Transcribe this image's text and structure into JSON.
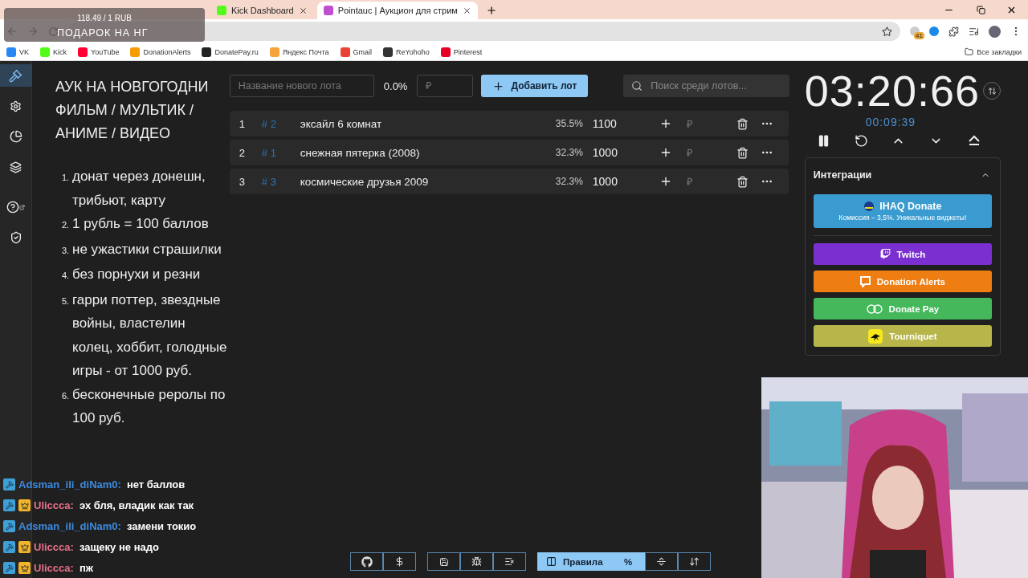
{
  "browser": {
    "tabs": [
      {
        "label": "Kick Dashboard",
        "selected": false,
        "color": "#53fc18"
      },
      {
        "label": "Pointauc | Аукцион для стрим",
        "selected": true,
        "color": "#c04fd0"
      }
    ],
    "bookmarks": [
      {
        "label": "VK",
        "color": "#2787f5"
      },
      {
        "label": "Kick",
        "color": "#53fc18"
      },
      {
        "label": "YouTube",
        "color": "#ff0033"
      },
      {
        "label": "DonationAlerts",
        "color": "#f59c07"
      },
      {
        "label": "DonatePay.ru",
        "color": "#222222"
      },
      {
        "label": "Яндекс Почта",
        "color": "#f7a23b"
      },
      {
        "label": "Gmail",
        "color": "#ea4335"
      },
      {
        "label": "ReYohoho",
        "color": "#333333"
      },
      {
        "label": "Pinterest",
        "color": "#e60023"
      }
    ],
    "all_bookmarks": "Все закладки",
    "extension_badge": "41"
  },
  "overlay_goal": {
    "amount": "118.49 / 1 RUB",
    "title": "ПОДАРОК НА НГ"
  },
  "rules": {
    "title": "АУК НА НОВГОГОДНИ ФИЛЬМ / МУЛЬТИК / АНИМЕ / ВИДЕО",
    "items": [
      {
        "number": "1.",
        "text": "донат через донешн, трибьют, карту"
      },
      {
        "number": "2.",
        "text": "1 рубль = 100 баллов"
      },
      {
        "number": "3.",
        "text": "не ужастики страшилки"
      },
      {
        "number": "4.",
        "text": "без порнухи и резни"
      },
      {
        "number": "5.",
        "text": "гарри поттер, звездные войны, властелин колец, хоббит, голодные игры - от 1000 руб."
      },
      {
        "number": "6.",
        "text": "бесконечные реролы по 100 руб."
      }
    ]
  },
  "new_lot": {
    "name_placeholder": "Название нового лота",
    "percent": "0.0%",
    "price_placeholder": "₽",
    "add_button": "Добавить лот",
    "search_placeholder": "Поиск среди лотов..."
  },
  "lots": [
    {
      "rank": "1",
      "id": "# 2",
      "name": "эксайл 6 комнат",
      "percent": "35.5%",
      "amount": "1100",
      "currency": "₽"
    },
    {
      "rank": "2",
      "id": "# 1",
      "name": "снежная пятерка (2008)",
      "percent": "32.3%",
      "amount": "1000",
      "currency": "₽"
    },
    {
      "rank": "3",
      "id": "# 3",
      "name": "космические друзья 2009",
      "percent": "32.3%",
      "amount": "1000",
      "currency": "₽"
    }
  ],
  "timer": {
    "main": "03:20:66",
    "elapsed": "00:09:39"
  },
  "integrations": {
    "title": "Интеграции",
    "expanded": true,
    "featured": {
      "label": "IHAQ Donate",
      "subtitle": "Комиссия – 3,5%. Уникальные виджеты!",
      "color": "#3a9bd0"
    },
    "items": [
      {
        "kind": "twitch",
        "label": "Twitch",
        "color": "#7b2fd0"
      },
      {
        "kind": "alerts",
        "label": "Donation Alerts",
        "color": "#ee7d12"
      },
      {
        "kind": "pay",
        "label": "Donate Pay",
        "color": "#44b85a"
      },
      {
        "kind": "tourniquet",
        "label": "Tourniquet",
        "color": "#b8b64a"
      }
    ]
  },
  "chat": [
    {
      "user": "Adsman_ili_diNam0:",
      "color": "#3d8be0",
      "badges": [
        {
          "kind": "mod"
        }
      ],
      "text": "нет баллов"
    },
    {
      "user": "Ulіccca:",
      "color": "#e8708a",
      "badges": [
        {
          "kind": "mod"
        },
        {
          "kind": "crown"
        }
      ],
      "text": "эх бля, владик как так"
    },
    {
      "user": "Adsman_ili_diNam0:",
      "color": "#3d8be0",
      "badges": [
        {
          "kind": "mod"
        }
      ],
      "text": "замени токио"
    },
    {
      "user": "Ulіccca:",
      "color": "#e8708a",
      "badges": [
        {
          "kind": "mod"
        },
        {
          "kind": "crown"
        }
      ],
      "text": "защеку не надо"
    },
    {
      "user": "Ulіccca:",
      "color": "#e8708a",
      "badges": [
        {
          "kind": "mod"
        },
        {
          "kind": "crown"
        }
      ],
      "text": "пж"
    }
  ],
  "toolbar": [
    {
      "kind": "github"
    },
    {
      "kind": "dollar"
    },
    {
      "kind": "save"
    },
    {
      "kind": "bug"
    },
    {
      "kind": "clear"
    },
    {
      "kind": "rules",
      "label": "Правила",
      "selected": true
    },
    {
      "kind": "percent",
      "label": "%",
      "selected": true
    },
    {
      "kind": "split",
      "selected": false
    },
    {
      "kind": "sort",
      "selected": false
    }
  ]
}
